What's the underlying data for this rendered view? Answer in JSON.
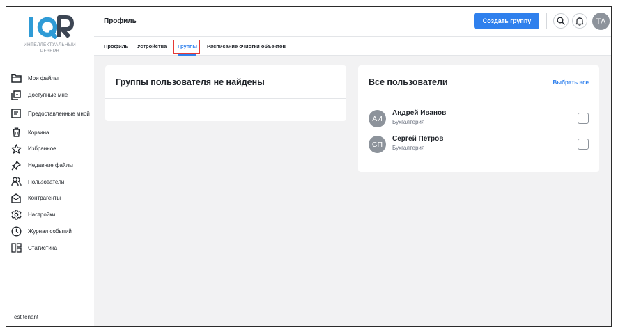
{
  "brand": {
    "logo_text": "IQR",
    "subtitle_line1": "ИНТЕЛЛЕКТУАЛЬНЫЙ",
    "subtitle_line2": "РЕЗЕРВ",
    "accent_color": "#2f9bd6"
  },
  "sidebar": {
    "items": [
      {
        "label": "Мои файлы",
        "icon": "folder-icon"
      },
      {
        "label": "Доступные мне",
        "icon": "shared-with-me-icon"
      },
      {
        "label": "Предоставленные мной",
        "icon": "shared-by-me-icon"
      },
      {
        "label": "Корзина",
        "icon": "trash-icon"
      },
      {
        "label": "Избранное",
        "icon": "star-icon"
      },
      {
        "label": "Недавние файлы",
        "icon": "pin-icon"
      },
      {
        "label": "Пользователи",
        "icon": "users-icon"
      },
      {
        "label": "Контрагенты",
        "icon": "contractors-icon"
      },
      {
        "label": "Настройки",
        "icon": "gear-icon"
      },
      {
        "label": "Журнал событий",
        "icon": "clock-icon"
      },
      {
        "label": "Статистика",
        "icon": "dashboard-icon"
      }
    ],
    "tenant": "Test tenant"
  },
  "header": {
    "title": "Профиль",
    "create_group_label": "Создать группу",
    "avatar_initials": "ТА"
  },
  "tabs": [
    {
      "label": "Профиль"
    },
    {
      "label": "Устройства"
    },
    {
      "label": "Группы",
      "active": true
    },
    {
      "label": "Расписание очистки объектов"
    }
  ],
  "groups_panel": {
    "title": "Группы пользователя не найдены"
  },
  "users_panel": {
    "title": "Все пользователи",
    "select_all_label": "Выбрать все",
    "users": [
      {
        "initials": "АИ",
        "name": "Андрей Иванов",
        "department": "Бухгалтерия",
        "checked": false
      },
      {
        "initials": "СП",
        "name": "Сергей Петров",
        "department": "Бухгалтерия",
        "checked": false
      }
    ]
  },
  "colors": {
    "primary": "#2f80ed",
    "highlight": "#e53935",
    "avatar_bg": "#8d939b",
    "page_bg": "#f2f2f3"
  }
}
